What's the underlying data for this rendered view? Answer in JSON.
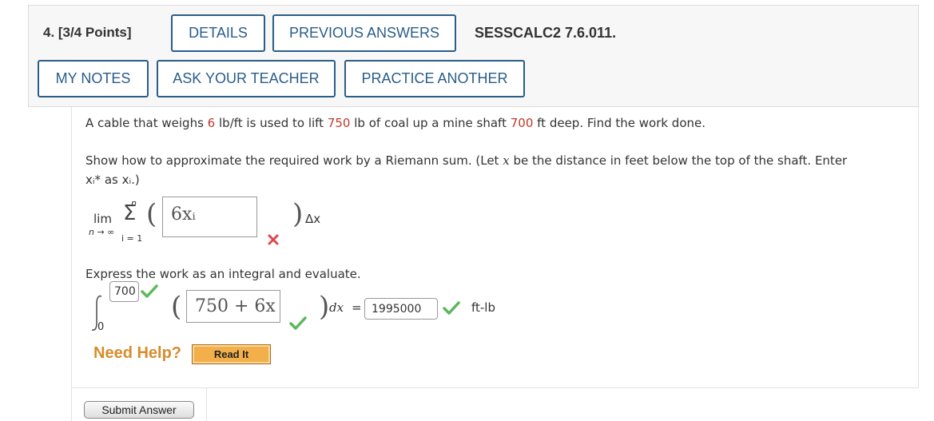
{
  "header": {
    "question_number": "4. [3/4 Points]",
    "details_button": "DETAILS",
    "previous_answers_button": "PREVIOUS ANSWERS",
    "problem_code": "SESSCALC2 7.6.011.",
    "my_notes_button": "MY NOTES",
    "ask_teacher_button": "ASK YOUR TEACHER",
    "practice_another_button": "PRACTICE ANOTHER"
  },
  "problem": {
    "line1_a": "A cable that weighs",
    "weight": "6",
    "line1_b": "lb/ft is used to lift",
    "coal": "750",
    "line1_c": "lb of coal up a mine shaft",
    "depth": "700",
    "line1_d": "ft deep. Find the work done."
  },
  "part1": {
    "instruction_a": "Show how to approximate the required work by a Riemann sum. (Let",
    "instruction_x": "x",
    "instruction_b": "be the distance in feet below the top of the shaft. Enter",
    "instruction_line2": "xᵢ* as xᵢ.)",
    "lim": "lim",
    "lim_sub": "n → ∞",
    "sum_top": "n",
    "sum_bottom": "i = 1",
    "sigma": "Σ",
    "answer": "6xᵢ",
    "delta_x": "Δx",
    "status": "incorrect"
  },
  "part2": {
    "instruction": "Express the work as an integral and evaluate.",
    "upper_limit": "700",
    "lower_limit": "0",
    "integrand": "750 + 6x",
    "dx": "dx",
    "equals": "=",
    "result": "1995000",
    "units": "ft-lb",
    "status": "correct"
  },
  "help": {
    "need_help": "Need Help?",
    "read_it": "Read It"
  },
  "submit": {
    "label": "Submit Answer"
  },
  "colors": {
    "accent": "#2a5d89",
    "highlight_value": "#c0392b",
    "correct": "#5cb85c",
    "incorrect": "#e04848",
    "help": "#d98b2b"
  }
}
